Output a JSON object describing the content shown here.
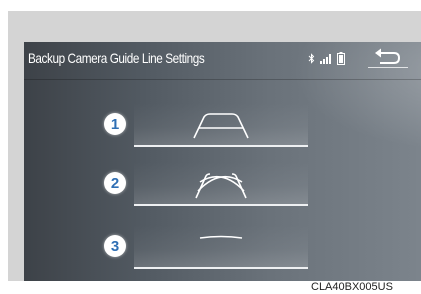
{
  "header": {
    "title": "Backup Camera Guide Line Settings",
    "status_icons": [
      "bluetooth-icon",
      "signal-strength-icon",
      "battery-icon"
    ],
    "back_icon": "back-arrow-icon"
  },
  "options": [
    {
      "number": "1",
      "icon": "fixed-guide-lines-icon"
    },
    {
      "number": "2",
      "icon": "estimated-course-lines-icon"
    },
    {
      "number": "3",
      "icon": "distance-guide-line-icon"
    }
  ],
  "caption": {
    "code": "CLA40BX005US"
  },
  "colors": {
    "badge_number": "#2f6fb4",
    "screen_dark": "#3d4248",
    "screen_light": "#7c848c"
  }
}
